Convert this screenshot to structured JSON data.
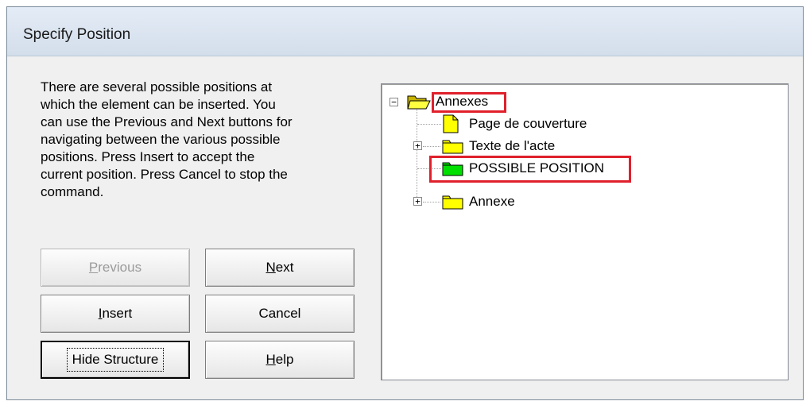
{
  "dialog": {
    "title": "Specify Position",
    "instructions": "There are several possible positions at\nwhich the element can be inserted. You\ncan use the Previous and Next buttons for\nnavigating between the various possible\npositions. Press Insert to accept the\ncurrent position. Press Cancel to stop the\ncommand."
  },
  "buttons": {
    "previous": {
      "label": "Previous",
      "enabled": false
    },
    "next": {
      "label": "Next"
    },
    "insert": {
      "label": "Insert"
    },
    "cancel": {
      "label": "Cancel"
    },
    "hide_structure": {
      "label": "Hide Structure"
    },
    "help": {
      "label": "Help"
    }
  },
  "tree": {
    "root": {
      "label": "Annexes",
      "expanded": true,
      "icon": "open-folder-icon"
    },
    "items": [
      {
        "label": "Page de couverture",
        "icon": "document-icon",
        "expandable": false
      },
      {
        "label": "Texte de l'acte",
        "icon": "folder-icon",
        "expandable": true
      },
      {
        "label": "POSSIBLE POSITION",
        "icon": "green-folder-icon",
        "expandable": false
      },
      {
        "label": "Annexe",
        "icon": "folder-icon",
        "expandable": true
      }
    ]
  },
  "colors": {
    "highlight": "#e0202c",
    "folder_yellow": "#ffff00",
    "possible_position_green": "#00e000"
  }
}
